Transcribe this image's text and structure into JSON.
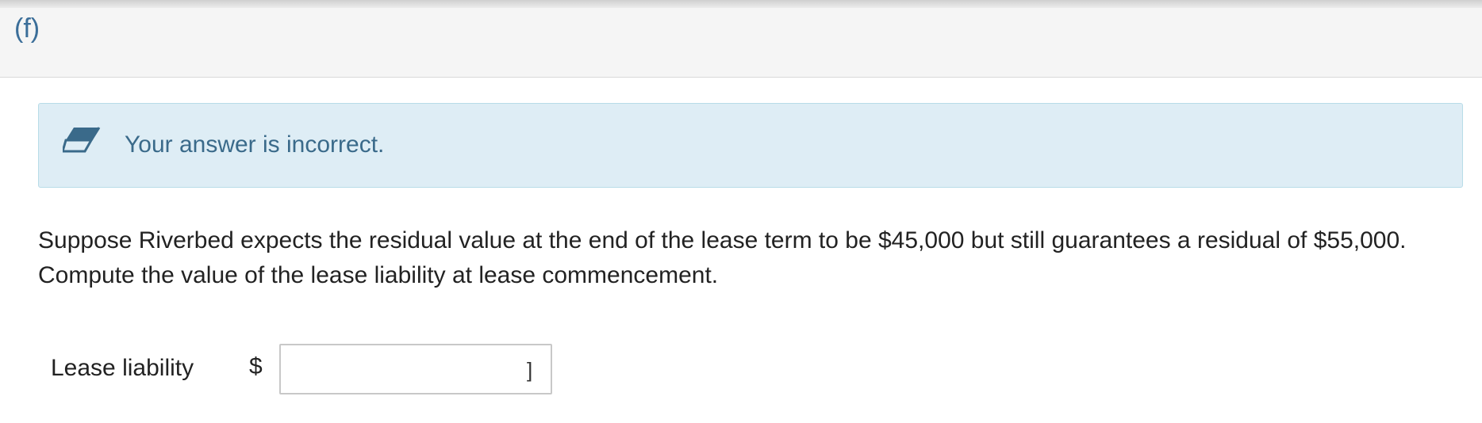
{
  "part": {
    "label": "(f)"
  },
  "feedback": {
    "icon": "eraser-icon",
    "message": "Your answer is incorrect.",
    "colors": {
      "background": "#deedf5",
      "border": "#b8dce8",
      "text": "#3a6a8a"
    }
  },
  "question": {
    "text": "Suppose Riverbed expects the residual value at the end of the lease term to be $45,000 but still guarantees a residual of $55,000. Compute the value of the lease liability at lease commencement."
  },
  "answer": {
    "label": "Lease liability",
    "currency_symbol": "$",
    "value": "",
    "trailing_mark": "]"
  }
}
